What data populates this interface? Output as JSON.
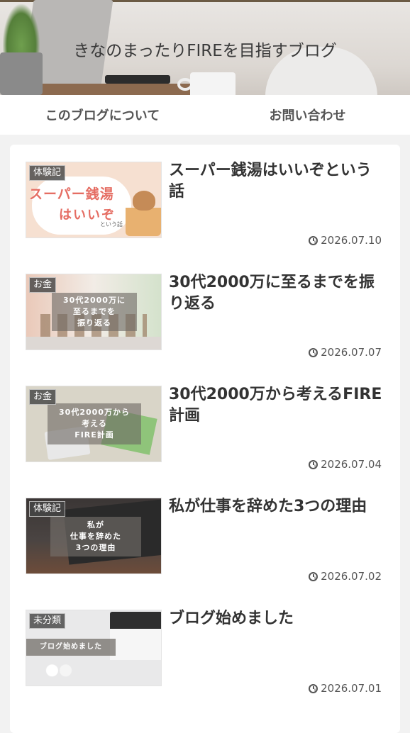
{
  "site": {
    "title": "きなのまったりFIREを目指すブログ"
  },
  "nav": {
    "items": [
      "このブログについて",
      "お問い合わせ"
    ]
  },
  "posts": [
    {
      "category": "体験記",
      "title": "スーパー銭湯はいいぞという話",
      "date": "2026.07.10",
      "thumb_text": {
        "main": "スーパー銭湯",
        "sub": "はいいぞ",
        "small": "という話"
      }
    },
    {
      "category": "お金",
      "title": "30代2000万に至るまでを振り返る",
      "date": "2026.07.07",
      "thumb_text": {
        "lines": [
          "30代2000万に",
          "至るまでを",
          "振り返る"
        ]
      }
    },
    {
      "category": "お金",
      "title": "30代2000万から考えるFIRE計画",
      "date": "2026.07.04",
      "thumb_text": {
        "lines": [
          "30代2000万から",
          "考える",
          "FIRE計画"
        ]
      }
    },
    {
      "category": "体験記",
      "title": "私が仕事を辞めた3つの理由",
      "date": "2026.07.02",
      "thumb_text": {
        "lines": [
          "私が",
          "仕事を辞めた",
          "3つの理由"
        ]
      }
    },
    {
      "category": "未分類",
      "title": "ブログ始めました",
      "date": "2026.07.01",
      "thumb_text": {
        "lines": [
          "ブログ始めました"
        ]
      }
    }
  ],
  "icons": {
    "date": "clock-icon"
  },
  "colors": {
    "accent_text": "#333333",
    "thumb_title_red": "#e56d63"
  }
}
